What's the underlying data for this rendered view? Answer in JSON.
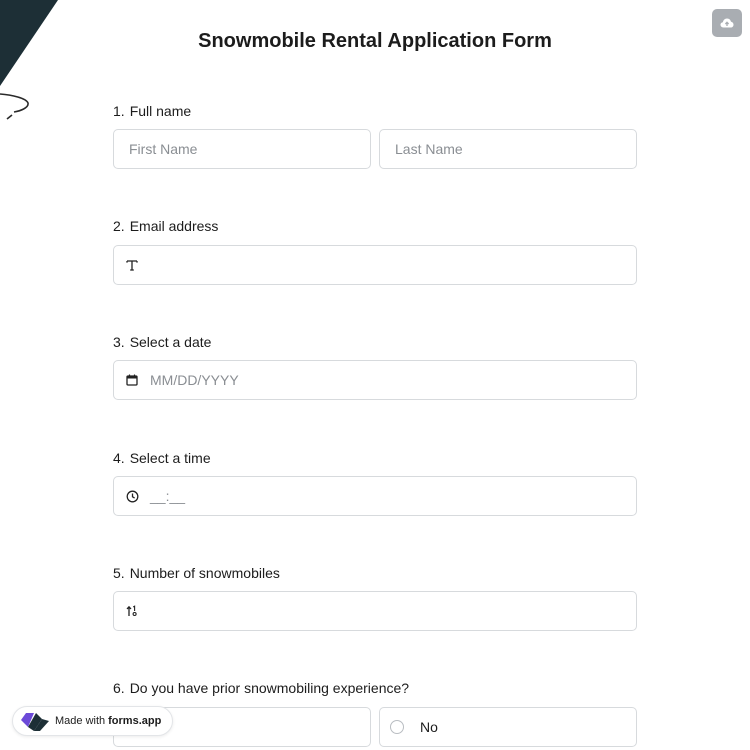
{
  "form": {
    "title": "Snowmobile Rental Application Form"
  },
  "questions": [
    {
      "number": "1.",
      "label": "Full name",
      "placeholders": [
        "First Name",
        "Last Name"
      ]
    },
    {
      "number": "2.",
      "label": "Email address",
      "icon": "text-icon"
    },
    {
      "number": "3.",
      "label": "Select a date",
      "placeholder": "MM/DD/YYYY",
      "icon": "calendar-icon"
    },
    {
      "number": "4.",
      "label": "Select a time",
      "placeholder": "__:__",
      "icon": "clock-icon"
    },
    {
      "number": "5.",
      "label": "Number of snowmobiles",
      "icon": "number-sort-icon"
    },
    {
      "number": "6.",
      "label": "Do you have prior snowmobiling experience?",
      "options": [
        "",
        "No"
      ]
    }
  ],
  "badge": {
    "prefix": "Made with",
    "brand": "forms.app"
  },
  "colors": {
    "corner": "#1d2f36",
    "border": "#d7dadd",
    "cloud_button": "#a9adb2",
    "logo_purple": "#6c4ad8"
  }
}
